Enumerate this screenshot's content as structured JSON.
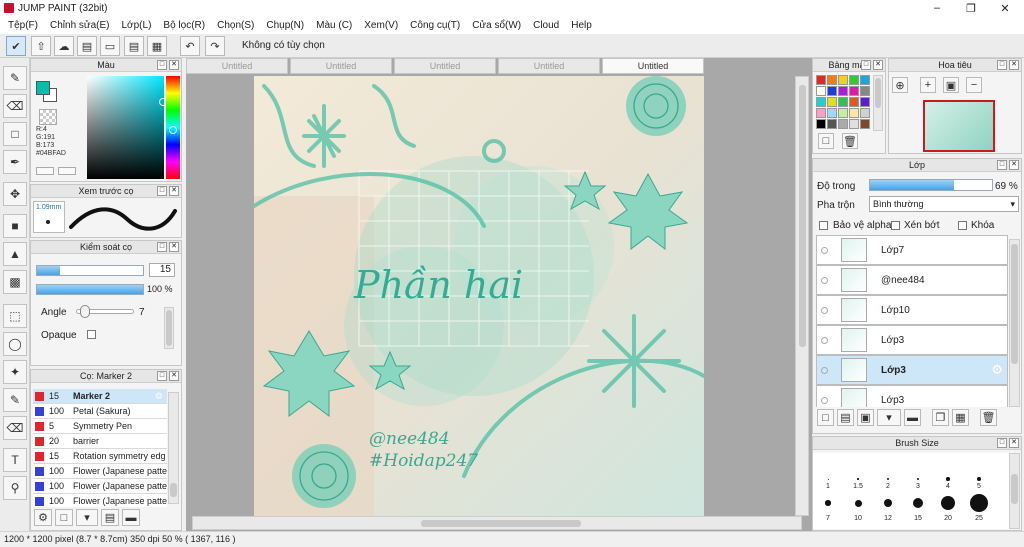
{
  "window": {
    "title": "JUMP PAINT (32bit)"
  },
  "menu": [
    "Tệp(F)",
    "Chỉnh sửa(E)",
    "Lớp(L)",
    "Bộ lọc(R)",
    "Chọn(S)",
    "Chụp(N)",
    "Màu (C)",
    "Xem(V)",
    "Công cụ(T)",
    "Cửa sổ(W)",
    "Cloud",
    "Help"
  ],
  "toolbar": {
    "no_selection": "Không có tùy chọn"
  },
  "color_panel": {
    "title": "Màu",
    "r": "R:4",
    "g": "G:191",
    "b": "B:173",
    "hex": "#04BFAD",
    "fg": "#04bfad",
    "bg": "#ffffff"
  },
  "preview_panel": {
    "title": "Xem trước cọ",
    "size": "1.09mm"
  },
  "brush_control": {
    "title": "Kiểm soát cọ",
    "size_value": "15",
    "opacity_value": "100 %",
    "angle_label": "Angle",
    "angle_value": "7",
    "opaque_label": "Opaque",
    "size_fill": 0.22,
    "opacity_fill": 1.0,
    "angle_fill": 0.06
  },
  "brush_list": {
    "title": "Cọ: Marker 2",
    "items": [
      {
        "num": "15",
        "name": "Marker 2",
        "color": "#e0262c",
        "selected": true
      },
      {
        "num": "100",
        "name": "Petal (Sakura)",
        "color": "#3340d9",
        "selected": false
      },
      {
        "num": "5",
        "name": "Symmetry Pen",
        "color": "#e0262c",
        "selected": false
      },
      {
        "num": "20",
        "name": "barrier",
        "color": "#e0262c",
        "selected": false
      },
      {
        "num": "15",
        "name": "Rotation symmetry edg",
        "color": "#e0262c",
        "selected": false
      },
      {
        "num": "100",
        "name": "Flower (Japanese patte",
        "color": "#3340d9",
        "selected": false
      },
      {
        "num": "100",
        "name": "Flower (Japanese patte",
        "color": "#3340d9",
        "selected": false
      },
      {
        "num": "100",
        "name": "Flower (Japanese patte",
        "color": "#3340d9",
        "selected": false
      }
    ]
  },
  "tabs": [
    "Untitled",
    "Untitled",
    "Untitled",
    "Untitled",
    "Untitled"
  ],
  "canvas": {
    "title_text": "Phần hai",
    "credit1": "@nee484",
    "credit2": "#Hoidap247"
  },
  "palette_panel": {
    "title": "Bảng màu"
  },
  "navigator": {
    "title": "Hoa tiêu"
  },
  "layers": {
    "title": "Lớp",
    "opacity_label": "Độ trong",
    "opacity_value": "69 %",
    "opacity_fill": 0.69,
    "blend_label": "Pha trộn",
    "blend_value": "Bình thường",
    "protect_alpha": "Bảo vệ alpha",
    "clipping": "Xén bớt",
    "lock": "Khóa",
    "items": [
      {
        "name": "Lớp7",
        "selected": false
      },
      {
        "name": "@nee484",
        "selected": false
      },
      {
        "name": "Lớp10",
        "selected": false
      },
      {
        "name": "Lớp3",
        "selected": false
      },
      {
        "name": "Lớp3",
        "selected": true
      },
      {
        "name": "Lớp3",
        "selected": false
      }
    ]
  },
  "brush_size": {
    "title": "Brush Size",
    "row1": [
      "1",
      "1.5",
      "2",
      "3",
      "4",
      "5"
    ],
    "row2": [
      "7",
      "10",
      "12",
      "15",
      "20",
      "25"
    ]
  },
  "status": {
    "text": "1200 * 1200 pixel   (8.7 * 8.7cm)   350 dpi   50 %   ( 1367, 116 )"
  }
}
